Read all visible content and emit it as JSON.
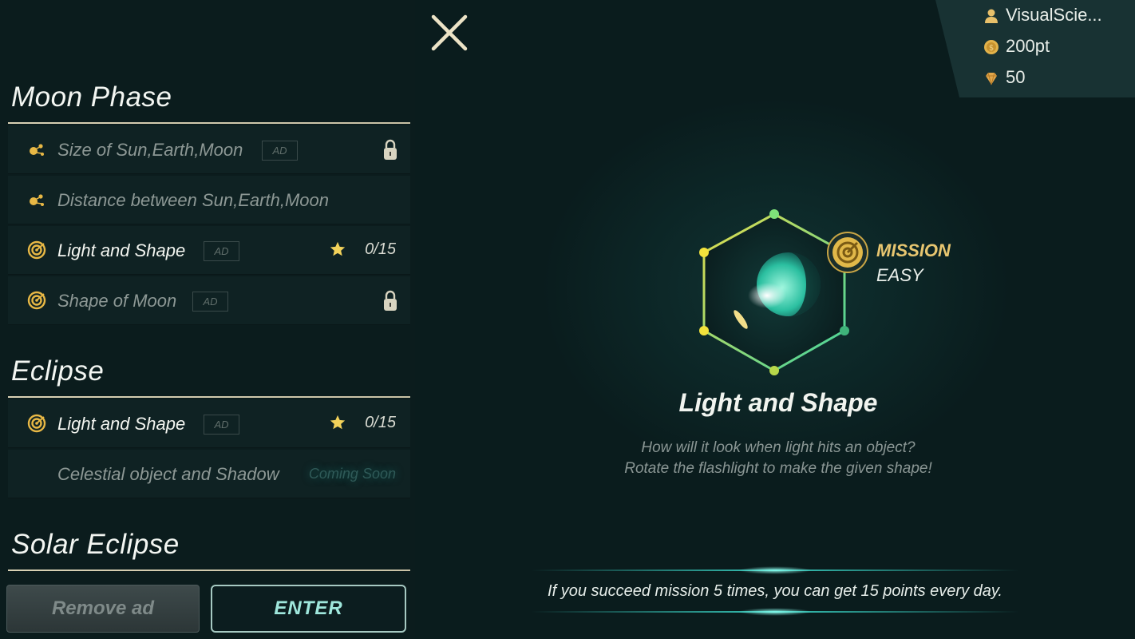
{
  "sidebar": {
    "sections": [
      {
        "title": "Moon Phase",
        "items": [
          {
            "label": "Size of Sun,Earth,Moon",
            "badge": "AD",
            "locked": true,
            "icon": "orbit-icon"
          },
          {
            "label": "Distance between Sun,Earth,Moon",
            "locked": false,
            "icon": "orbit-icon"
          },
          {
            "label": "Light and Shape",
            "badge": "AD",
            "progress": "0/15",
            "icon": "target-icon",
            "star": true
          },
          {
            "label": "Shape of Moon",
            "badge": "AD",
            "locked": true,
            "icon": "target-icon"
          }
        ]
      },
      {
        "title": "Eclipse",
        "items": [
          {
            "label": "Light and Shape",
            "badge": "AD",
            "progress": "0/15",
            "icon": "target-icon",
            "star": true
          },
          {
            "label": "Celestial object and Shadow",
            "status": "Coming Soon"
          }
        ]
      },
      {
        "title": "Solar Eclipse",
        "items": []
      }
    ],
    "remove_ad_label": "Remove ad",
    "enter_label": "ENTER"
  },
  "user": {
    "name": "VisualScie...",
    "points": "200pt",
    "gems": "50"
  },
  "mission": {
    "label": "MISSION",
    "level": "EASY",
    "title": "Light and Shape",
    "description_line1": "How will it look when light hits an object?",
    "description_line2": "Rotate the flashlight to make the given shape!",
    "reward_text": "If you succeed mission 5 times, you can get 15 points every day."
  },
  "colors": {
    "accent_gold": "#e8c670",
    "accent_teal": "#9fe7dc",
    "background": "#0a1d1e"
  }
}
